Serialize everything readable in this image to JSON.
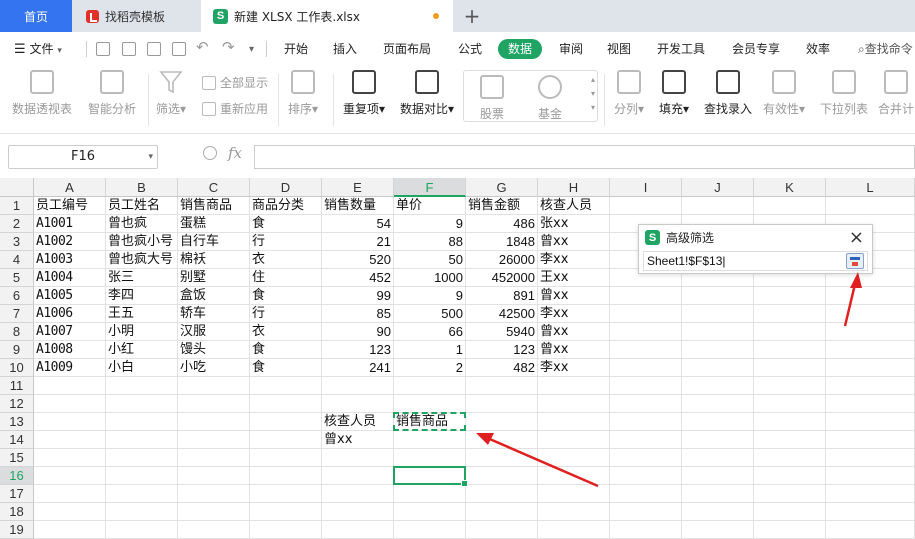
{
  "tabs": {
    "home": "首页",
    "template": "找稻壳模板",
    "document": "新建 XLSX 工作表.xlsx",
    "add": "+"
  },
  "menu": {
    "file": "文件",
    "items": [
      "开始",
      "插入",
      "页面布局",
      "公式",
      "数据",
      "审阅",
      "视图",
      "开发工具",
      "会员专享",
      "效率"
    ],
    "active": "数据",
    "search": "查找命令"
  },
  "ribbon": {
    "pivot": "数据透视表",
    "smart_analysis": "智能分析",
    "filter": "筛选",
    "show_all": "全部显示",
    "reapply": "重新应用",
    "sort": "排序",
    "duplicates": "重复项",
    "compare": "数据对比",
    "stock": "股票",
    "fund": "基金",
    "split": "分列",
    "fill": "填充",
    "lookup": "查找录入",
    "validity": "有效性",
    "dropdown": "下拉列表",
    "merge": "合并计"
  },
  "formula_bar": {
    "name_box": "F16",
    "fx": "fx",
    "value": ""
  },
  "grid": {
    "columns": [
      "A",
      "B",
      "C",
      "D",
      "E",
      "F",
      "G",
      "H",
      "I",
      "J",
      "K",
      "L"
    ],
    "selected_column": "F",
    "rows": [
      "1",
      "2",
      "3",
      "4",
      "5",
      "6",
      "7",
      "8",
      "9",
      "10",
      "11",
      "12",
      "13",
      "14",
      "15",
      "16",
      "17",
      "18",
      "19"
    ],
    "selected_row": "16",
    "header_row": [
      "员工编号",
      "员工姓名",
      "销售商品",
      "商品分类",
      "销售数量",
      "单价",
      "销售金额",
      "核查人员"
    ],
    "data": [
      [
        "A1001",
        "曾也疯",
        "蛋糕",
        "食",
        "54",
        "9",
        "486",
        "张xx"
      ],
      [
        "A1002",
        "曾也疯小号",
        "自行车",
        "行",
        "21",
        "88",
        "1848",
        "曾xx"
      ],
      [
        "A1003",
        "曾也疯大号",
        "棉袄",
        "衣",
        "520",
        "50",
        "26000",
        "李xx"
      ],
      [
        "A1004",
        "张三",
        "别墅",
        "住",
        "452",
        "1000",
        "452000",
        "王xx"
      ],
      [
        "A1005",
        "李四",
        "盒饭",
        "食",
        "99",
        "9",
        "891",
        "曾xx"
      ],
      [
        "A1006",
        "王五",
        "轿车",
        "行",
        "85",
        "500",
        "42500",
        "李xx"
      ],
      [
        "A1007",
        "小明",
        "汉服",
        "衣",
        "90",
        "66",
        "5940",
        "曾xx"
      ],
      [
        "A1008",
        "小红",
        "馒头",
        "食",
        "123",
        "1",
        "123",
        "曾xx"
      ],
      [
        "A1009",
        "小白",
        "小吃",
        "食",
        "241",
        "2",
        "482",
        "李xx"
      ]
    ],
    "criteria": {
      "e13": "核查人员",
      "f13": "销售商品",
      "e14": "曾xx"
    }
  },
  "dialog": {
    "title": "高级筛选",
    "close": "×",
    "range": "Sheet1!$F$13"
  },
  "colors": {
    "accent": "#1fa464",
    "home_tab": "#3574f0",
    "arrow": "#e02020"
  }
}
